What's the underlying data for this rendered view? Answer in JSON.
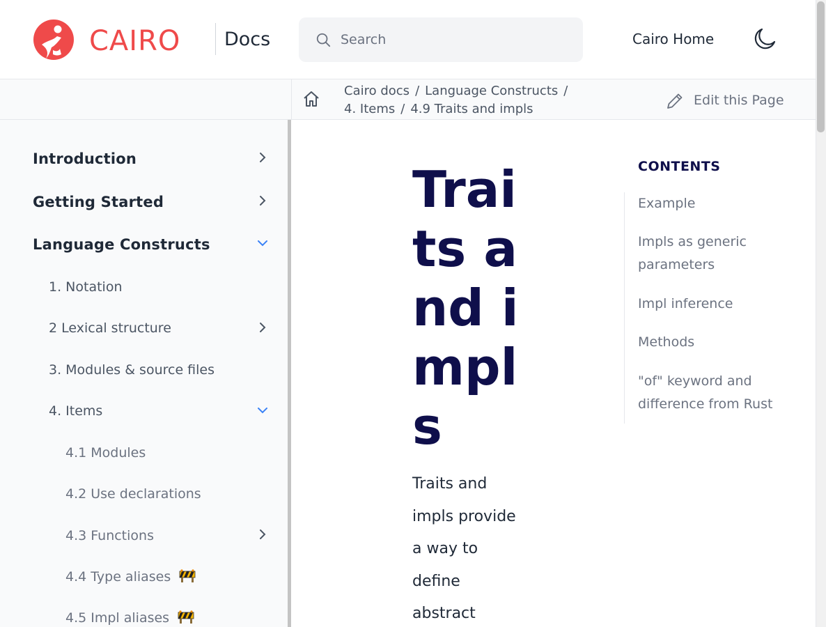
{
  "header": {
    "brand": "CAIRO",
    "docs_label": "Docs",
    "search_placeholder": "Search",
    "home_link": "Cairo Home",
    "brand_color": "#ef4a4a"
  },
  "breadcrumb": {
    "items": [
      "Cairo docs",
      "Language Constructs",
      "4. Items",
      "4.9 Traits and impls"
    ],
    "separator": "/",
    "edit_label": "Edit this Page"
  },
  "sidebar": {
    "items": [
      {
        "label": "Introduction",
        "level": 1,
        "chevron": "right"
      },
      {
        "label": "Getting Started",
        "level": 1,
        "chevron": "right"
      },
      {
        "label": "Language Constructs",
        "level": 1,
        "chevron": "down"
      },
      {
        "label": "1. Notation",
        "level": 2,
        "chevron": ""
      },
      {
        "label": "2 Lexical structure",
        "level": 2,
        "chevron": "right"
      },
      {
        "label": "3. Modules & source files",
        "level": 2,
        "chevron": ""
      },
      {
        "label": "4. Items",
        "level": 2,
        "chevron": "down"
      },
      {
        "label": "4.1 Modules",
        "level": 3,
        "chevron": ""
      },
      {
        "label": "4.2 Use declarations",
        "level": 3,
        "chevron": ""
      },
      {
        "label": "4.3 Functions",
        "level": 3,
        "chevron": "right"
      },
      {
        "label": "4.4 Type aliases",
        "level": 3,
        "chevron": "",
        "badge": "construction-icon"
      },
      {
        "label": "4.5 Impl aliases",
        "level": 3,
        "chevron": "",
        "badge": "construction-icon"
      }
    ]
  },
  "main": {
    "title": "Traits and impls",
    "intro": "Traits and impls provide a way to define abstract"
  },
  "toc": {
    "heading": "CONTENTS",
    "items": [
      "Example",
      "Impls as generic parameters",
      "Impl inference",
      "Methods",
      "\"of\" keyword and difference from Rust"
    ]
  },
  "colors": {
    "title": "#0f0f4b",
    "accent_chevron": "#3b82f6"
  }
}
